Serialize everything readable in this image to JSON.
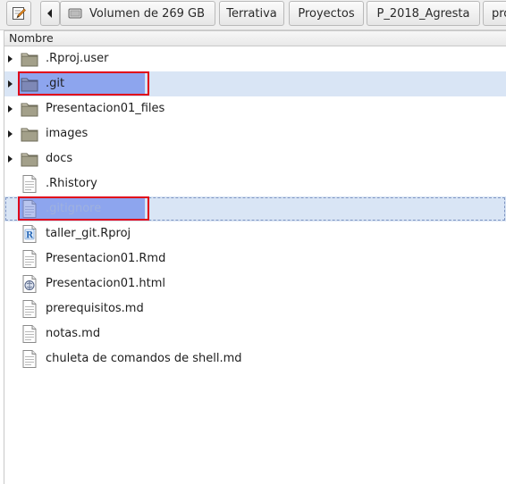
{
  "pathbar": {
    "edit_icon": "edit-pencil-icon",
    "back_icon": "left-arrow-icon",
    "volume_icon": "drive-icon",
    "volume_label": "Volumen de 269 GB",
    "crumbs": [
      "Terrativa",
      "Proyectos",
      "P_2018_Agresta",
      "pro"
    ]
  },
  "list": {
    "column_header": "Nombre",
    "items": [
      {
        "name": ".Rproj.user",
        "type": "folder",
        "expandable": true
      },
      {
        "name": ".git",
        "type": "folder",
        "expandable": true,
        "selected": true,
        "highlighted": true
      },
      {
        "name": "Presentacion01_files",
        "type": "folder",
        "expandable": true
      },
      {
        "name": "images",
        "type": "folder",
        "expandable": true
      },
      {
        "name": "docs",
        "type": "folder",
        "expandable": true
      },
      {
        "name": ".Rhistory",
        "type": "text-file"
      },
      {
        "name": ".gitignore",
        "type": "text-file",
        "selected": true,
        "highlighted": true
      },
      {
        "name": "taller_git.Rproj",
        "type": "rproj-file"
      },
      {
        "name": "Presentacion01.Rmd",
        "type": "text-file"
      },
      {
        "name": "Presentacion01.html",
        "type": "html-file"
      },
      {
        "name": "prerequisitos.md",
        "type": "text-file"
      },
      {
        "name": "notas.md",
        "type": "text-file"
      },
      {
        "name": "chuleta de comandos de shell.md",
        "type": "text-file"
      }
    ]
  },
  "colors": {
    "selection_row": "#d9e5f5",
    "selection_item": "#8da5ee",
    "annotation_box": "#e0001a",
    "folder": "#a3a08a"
  }
}
